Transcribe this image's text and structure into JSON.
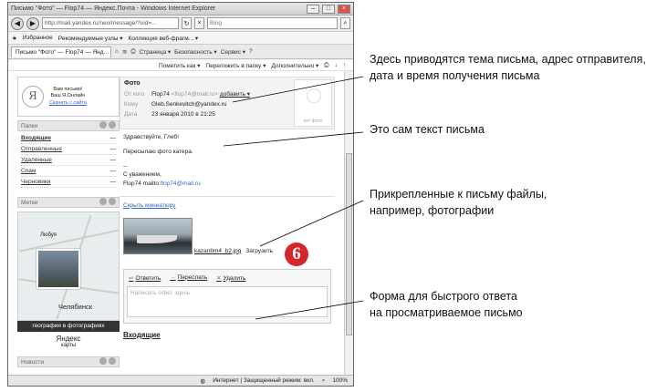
{
  "window": {
    "title": "Письмо \"Фото\" — Flop74 — Яндекс.Почта - Windows Internet Explorer",
    "url": "http://mail.yandex.ru/neo/message/?uid=...",
    "search_placeholder": "Bing"
  },
  "favorites": {
    "label": "Избранное",
    "items": [
      "Рекомендуемые узлы ▾",
      "Коллекция веб-фрагм... ▾"
    ]
  },
  "tab": {
    "label": "Письмо \"Фото\" — Flop74 — Янд...",
    "tools": [
      "Страница ▾",
      "Безопасность ▾",
      "Сервис ▾"
    ]
  },
  "mail_tools": [
    "Пометить как ▾",
    "Переложить в папку ▾",
    "Дополнительно ▾"
  ],
  "user": {
    "line1": "Вам письмо!",
    "line2": "Ваш Я.Онлайн",
    "link": "Скачать с сайта"
  },
  "folders": {
    "header": "Папки",
    "items": [
      {
        "name": "Входящие",
        "count": "—"
      },
      {
        "name": "Отправленные",
        "count": "—"
      },
      {
        "name": "Удаленные",
        "count": "—"
      },
      {
        "name": "Спам",
        "count": "—"
      },
      {
        "name": "Черновики",
        "count": "—"
      }
    ]
  },
  "labels": {
    "header": "Метки"
  },
  "map": {
    "city": "Челябинск",
    "town": "Любуя",
    "caption": "география в фотографиях",
    "brand": "Яндекс",
    "brand_sub": "карты"
  },
  "news": {
    "header": "Новости"
  },
  "message": {
    "subject": "Фото",
    "from_label": "От кого",
    "from_name": "Flop74",
    "from_email": "<flop74@mail.ru>",
    "add": "добавить ▾",
    "to_label": "Кому",
    "to_email": "Gleb.Senkevitch@yandex.ru",
    "date_label": "Дата",
    "date": "23 января 2010 в 21:25",
    "avatar_text": "нет фото",
    "greeting": "Здравствуйте, Глеб!",
    "body": "Пересылаю фото катера.",
    "sig1": "--",
    "sig2": "С уважением,",
    "sig3": "Flop74 mailto:",
    "sig_link": "flop74@mail.ru",
    "hide_thumbs": "Скрыть миниатюру",
    "attachment_name": "kazanbm4_b2.jpg",
    "download": "Загрузить"
  },
  "reply": {
    "reply": "Ответить",
    "forward": "Переслать",
    "delete": "Удалить",
    "placeholder": "Написать ответ здесь"
  },
  "inbox_link": "Входящие",
  "status": {
    "zone": "Интернет | Защищенный режим: вкл.",
    "zoom": "100%"
  },
  "badge": "6",
  "callouts": {
    "c1_l1": "Здесь приводятся тема письма, адрес отправителя,",
    "c1_l2": "дата и время получения письма",
    "c2": "Это сам текст письма",
    "c3_l1": "Прикрепленные к письму файлы,",
    "c3_l2": "например, фотографии",
    "c4_l1": "Форма для быстрого ответа",
    "c4_l2": "на просматриваемое письмо"
  }
}
